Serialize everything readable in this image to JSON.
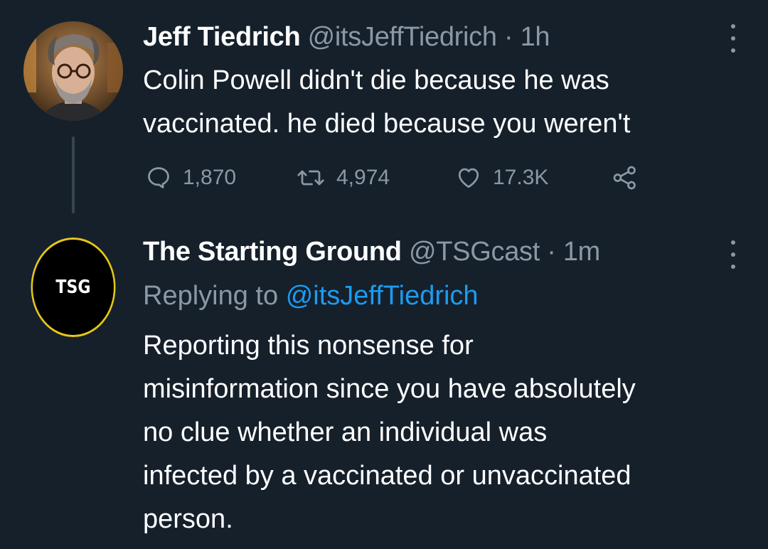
{
  "tweets": [
    {
      "author_name": "Jeff Tiedrich",
      "handle_time": "@itsJeffTiedrich · 1h",
      "text_lines": [
        "Colin Powell didn't die because he was",
        "vaccinated. he died because you weren't"
      ],
      "actions": {
        "replies": "1,870",
        "retweets": "4,974",
        "likes": "17.3K"
      },
      "avatar_icon": "user-photo-avatar"
    },
    {
      "author_name": "The Starting Ground",
      "handle_time": "@TSGcast · 1m",
      "replying_label": "Replying to",
      "replying_to": "@itsJeffTiedrich",
      "text_lines": [
        "Reporting this nonsense for",
        "misinformation since you have absolutely",
        "no clue whether an individual was",
        "infected by a vaccinated or unvaccinated",
        "person."
      ],
      "avatar_text": "TSG"
    }
  ],
  "colors": {
    "background": "#15202b",
    "secondary_text": "#8b98a5",
    "link": "#1d9bf0",
    "thread_line": "#38444d",
    "tsg_ring": "#e6c619"
  }
}
